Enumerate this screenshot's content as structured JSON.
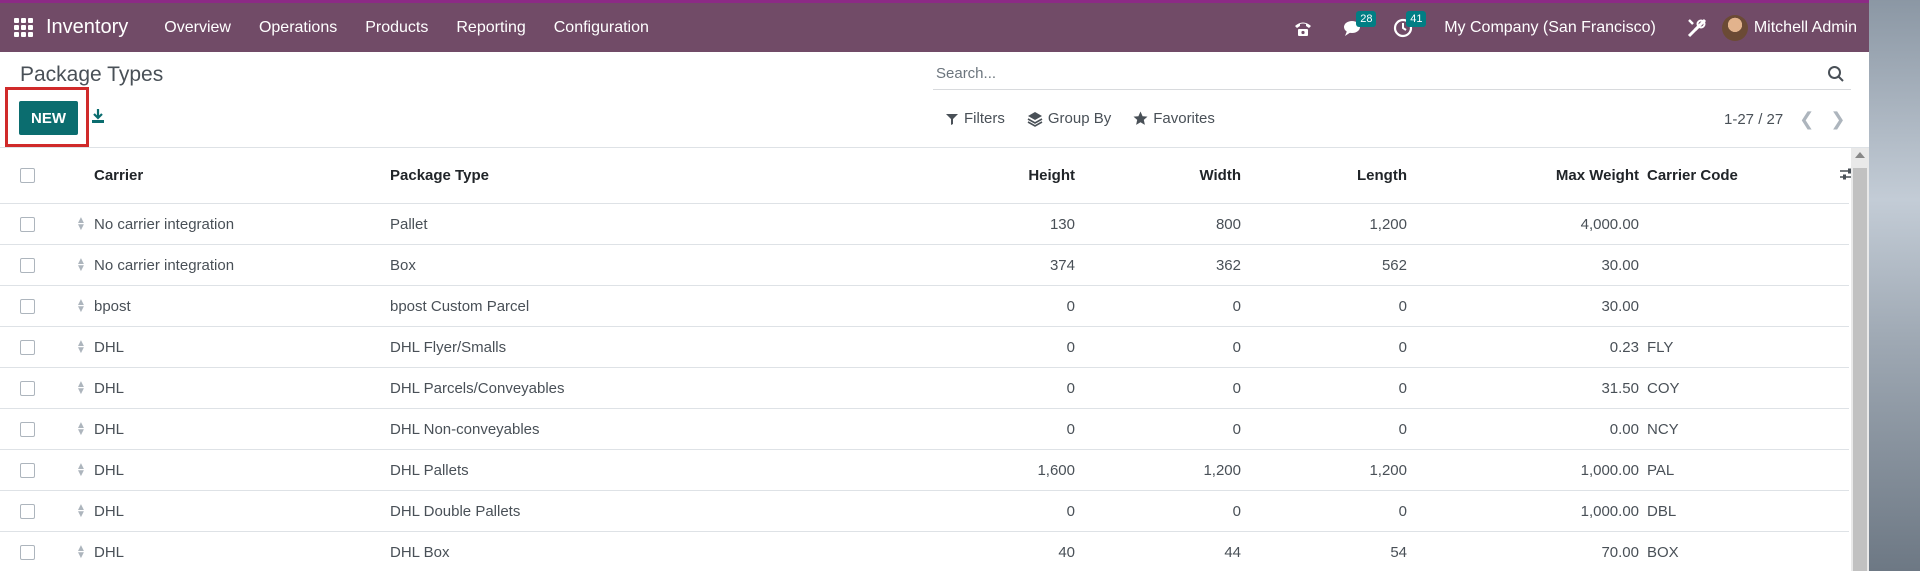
{
  "app": {
    "name": "Inventory",
    "menu": [
      "Overview",
      "Operations",
      "Products",
      "Reporting",
      "Configuration"
    ],
    "messages_count": "28",
    "activities_count": "41",
    "company": "My Company (San Francisco)",
    "user": "Mitchell Admin"
  },
  "page": {
    "title": "Package Types",
    "new_label": "NEW",
    "search_placeholder": "Search...",
    "filters_label": "Filters",
    "group_by_label": "Group By",
    "favorites_label": "Favorites",
    "pager": "1-27 / 27"
  },
  "table": {
    "headers": {
      "carrier": "Carrier",
      "package_type": "Package Type",
      "height": "Height",
      "width": "Width",
      "length": "Length",
      "max_weight": "Max Weight",
      "carrier_code": "Carrier Code"
    },
    "rows": [
      {
        "carrier": "No carrier integration",
        "package_type": "Pallet",
        "height": "130",
        "width": "800",
        "length": "1,200",
        "max_weight": "4,000.00",
        "carrier_code": ""
      },
      {
        "carrier": "No carrier integration",
        "package_type": "Box",
        "height": "374",
        "width": "362",
        "length": "562",
        "max_weight": "30.00",
        "carrier_code": ""
      },
      {
        "carrier": "bpost",
        "package_type": "bpost Custom Parcel",
        "height": "0",
        "width": "0",
        "length": "0",
        "max_weight": "30.00",
        "carrier_code": ""
      },
      {
        "carrier": "DHL",
        "package_type": "DHL Flyer/Smalls",
        "height": "0",
        "width": "0",
        "length": "0",
        "max_weight": "0.23",
        "carrier_code": "FLY"
      },
      {
        "carrier": "DHL",
        "package_type": "DHL Parcels/Conveyables",
        "height": "0",
        "width": "0",
        "length": "0",
        "max_weight": "31.50",
        "carrier_code": "COY"
      },
      {
        "carrier": "DHL",
        "package_type": "DHL Non-conveyables",
        "height": "0",
        "width": "0",
        "length": "0",
        "max_weight": "0.00",
        "carrier_code": "NCY"
      },
      {
        "carrier": "DHL",
        "package_type": "DHL Pallets",
        "height": "1,600",
        "width": "1,200",
        "length": "1,200",
        "max_weight": "1,000.00",
        "carrier_code": "PAL"
      },
      {
        "carrier": "DHL",
        "package_type": "DHL Double Pallets",
        "height": "0",
        "width": "0",
        "length": "0",
        "max_weight": "1,000.00",
        "carrier_code": "DBL"
      },
      {
        "carrier": "DHL",
        "package_type": "DHL Box",
        "height": "40",
        "width": "44",
        "length": "54",
        "max_weight": "70.00",
        "carrier_code": "BOX"
      }
    ]
  },
  "icons": {
    "apps": "apps-grid-icon",
    "phone": "phone-icon",
    "chat": "chat-icon",
    "activity": "clock-icon",
    "debug": "tools-icon",
    "download": "download-icon",
    "search": "search-icon",
    "filter": "filter-icon",
    "group": "layers-icon",
    "favorite": "star-icon",
    "settings": "column-settings-icon"
  },
  "colors": {
    "navbar": "#714b67",
    "primary_button": "#0b6d6f",
    "badge": "#017e84",
    "highlight": "#d02a2a"
  }
}
